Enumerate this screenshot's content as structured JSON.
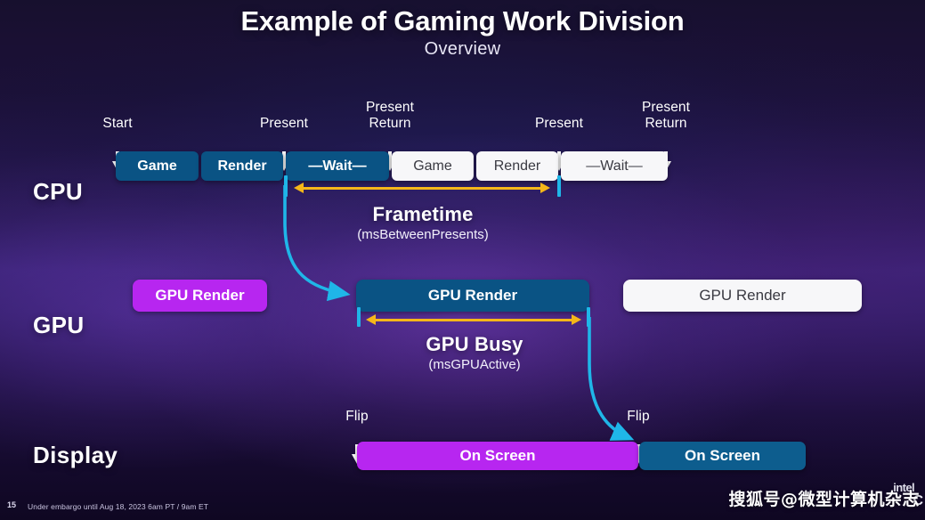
{
  "slide": {
    "title": "Example of Gaming Work Division",
    "subtitle": "Overview",
    "page_number": "15",
    "embargo_note": "Under embargo until Aug 18, 2023 6am PT / 9am ET",
    "watermark": "搜狐号@微型计算机杂志",
    "brand_logo": "intel",
    "brand_mark": "C"
  },
  "colors": {
    "cpu_block_blue": "#0a5384",
    "cpu_block_white": "#f7f7f9",
    "gpu_block_magenta": "#b726f0",
    "gpu_block_blue": "#0a5384",
    "gpu_block_white": "#f7f7f9",
    "onscreen_magenta": "#b726f0",
    "onscreen_teal": "#0d5d8e",
    "measure_arrow_yellow": "#f5b719",
    "tick_cyan": "#1fb6e8",
    "connector_cyan": "#1fb6e8",
    "text_white": "#ffffff"
  },
  "rows": {
    "cpu": {
      "label": "CPU"
    },
    "gpu": {
      "label": "GPU"
    },
    "display": {
      "label": "Display"
    }
  },
  "cpu_markers": [
    {
      "caption": "Start"
    },
    {
      "caption": "Present"
    },
    {
      "caption": "Present\nReturn"
    },
    {
      "caption": "Present"
    },
    {
      "caption": "Present\nReturn"
    }
  ],
  "cpu_blocks": [
    {
      "label": "Game",
      "style": "blue"
    },
    {
      "label": "Render",
      "style": "blue"
    },
    {
      "label": "—Wait—",
      "style": "blue"
    },
    {
      "label": "Game",
      "style": "white"
    },
    {
      "label": "Render",
      "style": "white"
    },
    {
      "label": "—Wait—",
      "style": "white"
    }
  ],
  "gpu_blocks": [
    {
      "label": "GPU Render",
      "style": "magenta"
    },
    {
      "label": "GPU Render",
      "style": "blue"
    },
    {
      "label": "GPU Render",
      "style": "white"
    }
  ],
  "display_markers": [
    {
      "caption": "Flip"
    },
    {
      "caption": "Flip"
    }
  ],
  "display_blocks": [
    {
      "label": "On Screen",
      "style": "magenta"
    },
    {
      "label": "On Screen",
      "style": "teal"
    }
  ],
  "annotations": {
    "frametime": {
      "title": "Frametime",
      "metric": "(msBetweenPresents)"
    },
    "gpu_busy": {
      "title": "GPU Busy",
      "metric": "(msGPUActive)"
    }
  }
}
